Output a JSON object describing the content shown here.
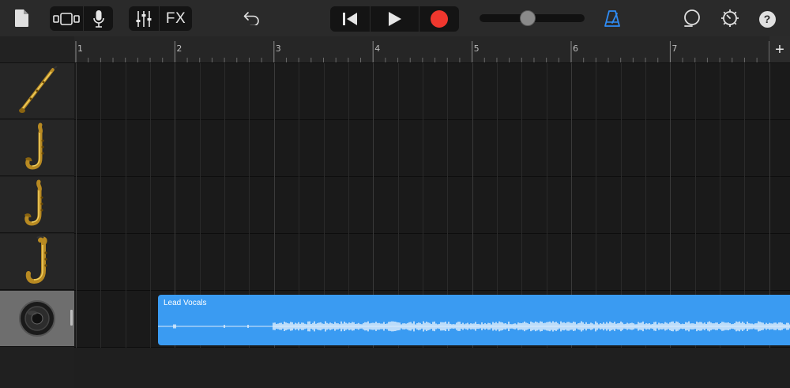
{
  "toolbar": {
    "fx_label": "FX",
    "icons": [
      "document-icon",
      "browser-icon",
      "microphone-icon",
      "mixer-icon",
      "undo-icon",
      "go-to-start-icon",
      "play-icon",
      "record-icon",
      "metronome-icon",
      "loop-icon",
      "settings-icon",
      "help-icon"
    ],
    "master_volume": 0.45,
    "record_color": "#f0372e",
    "metronome_color": "#2f8cf5",
    "help_label": "?"
  },
  "ruler": {
    "bars": [
      "1",
      "2",
      "3",
      "4",
      "5",
      "6",
      "7"
    ],
    "add_label": "+"
  },
  "tracks": [
    {
      "instrument": "soprano-saxophone-icon"
    },
    {
      "instrument": "alto-saxophone-icon"
    },
    {
      "instrument": "tenor-saxophone-icon"
    },
    {
      "instrument": "baritone-saxophone-icon"
    },
    {
      "instrument": "speaker-icon",
      "selected": true
    }
  ],
  "region": {
    "name": "Lead Vocals",
    "color": "#3a9bf2"
  }
}
